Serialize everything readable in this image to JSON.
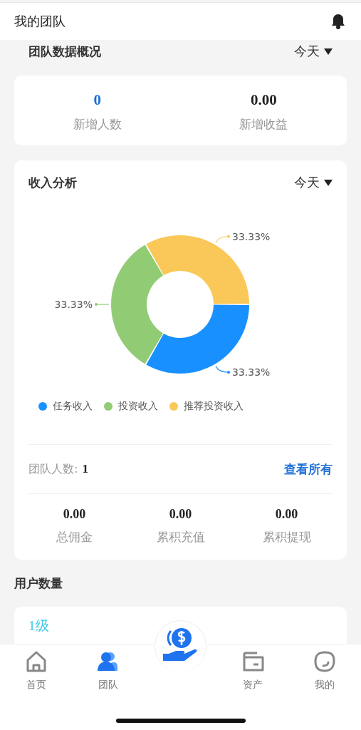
{
  "header": {
    "title": "我的团队"
  },
  "overview": {
    "title": "团队数据概况",
    "period": "今天",
    "stats": [
      {
        "value": "0",
        "label": "新增人数",
        "highlight": true
      },
      {
        "value": "0.00",
        "label": "新增收益",
        "highlight": false
      }
    ]
  },
  "income": {
    "title": "收入分析",
    "period": "今天",
    "chart_data": {
      "type": "donut",
      "categories": [
        "任务收入",
        "投资收入",
        "推荐投资收入"
      ],
      "values": [
        33.33,
        33.33,
        33.33
      ],
      "colors": [
        "#1890ff",
        "#91cc75",
        "#fac858"
      ],
      "data_labels": true,
      "value_labels": [
        "33.33%",
        "33.33%",
        "33.33%"
      ]
    },
    "team_count_label": "团队人数:",
    "team_count": "1",
    "view_all": "查看所有",
    "totals": [
      {
        "value": "0.00",
        "label": "总佣金"
      },
      {
        "value": "0.00",
        "label": "累积充值"
      },
      {
        "value": "0.00",
        "label": "累积提现"
      }
    ]
  },
  "users": {
    "title": "用户数量",
    "level": "1级"
  },
  "tabbar": {
    "items": [
      {
        "kind": "home",
        "label": "首页",
        "selected": false
      },
      {
        "kind": "team",
        "label": "团队",
        "selected": true
      },
      {
        "kind": "center"
      },
      {
        "kind": "wallet",
        "label": "资产",
        "selected": false
      },
      {
        "kind": "me",
        "label": "我的",
        "selected": false
      }
    ]
  }
}
